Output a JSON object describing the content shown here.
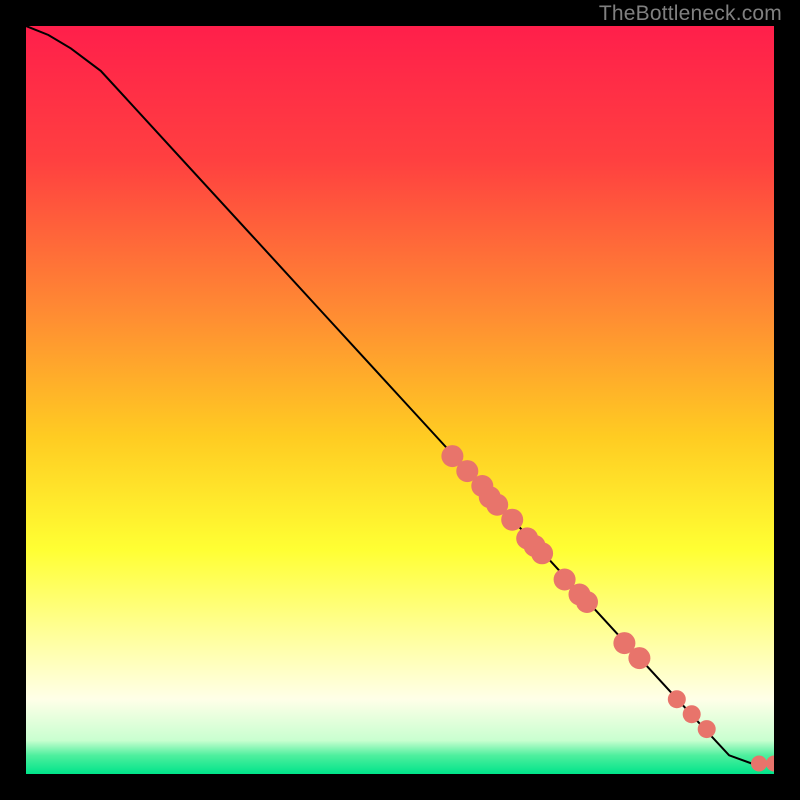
{
  "attribution": "TheBottleneck.com",
  "chart_data": {
    "type": "line",
    "title": "",
    "xlabel": "",
    "ylabel": "",
    "xlim": [
      0,
      100
    ],
    "ylim": [
      0,
      100
    ],
    "gradient_stops": [
      {
        "offset": 0.0,
        "color": "#ff1f4b"
      },
      {
        "offset": 0.18,
        "color": "#ff4040"
      },
      {
        "offset": 0.38,
        "color": "#ff8a33"
      },
      {
        "offset": 0.55,
        "color": "#ffcc22"
      },
      {
        "offset": 0.7,
        "color": "#ffff33"
      },
      {
        "offset": 0.82,
        "color": "#ffffa0"
      },
      {
        "offset": 0.9,
        "color": "#ffffe8"
      },
      {
        "offset": 0.955,
        "color": "#c9ffd0"
      },
      {
        "offset": 0.975,
        "color": "#4fef9e"
      },
      {
        "offset": 1.0,
        "color": "#00e48a"
      }
    ],
    "series": [
      {
        "name": "bottleneck-curve",
        "type": "line",
        "color": "#000000",
        "x": [
          0,
          3,
          6,
          10,
          20,
          30,
          40,
          50,
          60,
          70,
          80,
          90,
          94,
          97,
          100
        ],
        "y": [
          100,
          98.8,
          97.0,
          94.0,
          83.1,
          72.2,
          61.3,
          50.4,
          39.5,
          28.6,
          17.7,
          6.8,
          2.5,
          1.4,
          1.4
        ]
      },
      {
        "name": "sample-points",
        "type": "scatter",
        "color": "#e8746b",
        "x": [
          57,
          59,
          61,
          62,
          63,
          65,
          67,
          68,
          69,
          72,
          74,
          75,
          80,
          82,
          87,
          89,
          91,
          98,
          100
        ],
        "y": [
          42.5,
          40.5,
          38.5,
          37,
          36,
          34,
          31.5,
          30.5,
          29.5,
          26,
          24,
          23,
          17.5,
          15.5,
          10,
          8,
          6,
          1.4,
          1.4
        ],
        "r": [
          11,
          11,
          11,
          11,
          11,
          11,
          11,
          11,
          11,
          11,
          11,
          11,
          11,
          11,
          9,
          9,
          9,
          8,
          8
        ]
      }
    ]
  }
}
